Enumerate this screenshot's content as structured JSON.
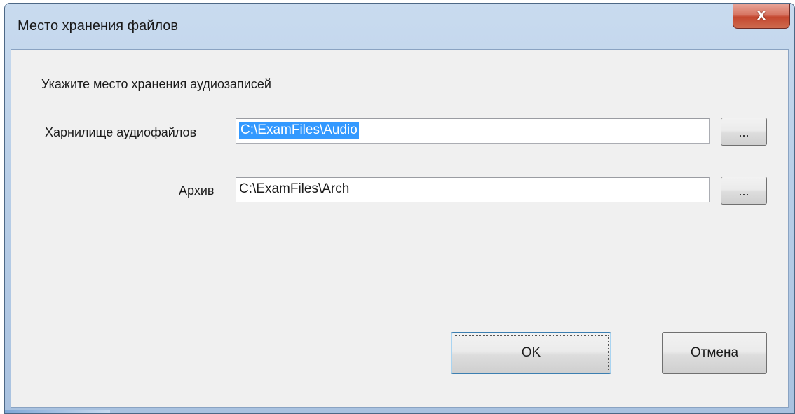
{
  "window": {
    "title": "Место хранения файлов",
    "close_glyph": "x"
  },
  "dialog": {
    "instruction": "Укажите место хранения аудиозаписей",
    "audio_storage": {
      "label": "Харнилище аудиофайлов",
      "value": "C:\\ExamFiles\\Audio",
      "selected": true,
      "browse_label": "..."
    },
    "archive": {
      "label": "Архив",
      "value": "C:\\ExamFiles\\Arch",
      "browse_label": "..."
    },
    "ok_label": "OK",
    "cancel_label": "Отмена"
  },
  "colors": {
    "selection": "#3399ff",
    "close_button": "#c4472f",
    "frame": "#b9cfe8"
  }
}
